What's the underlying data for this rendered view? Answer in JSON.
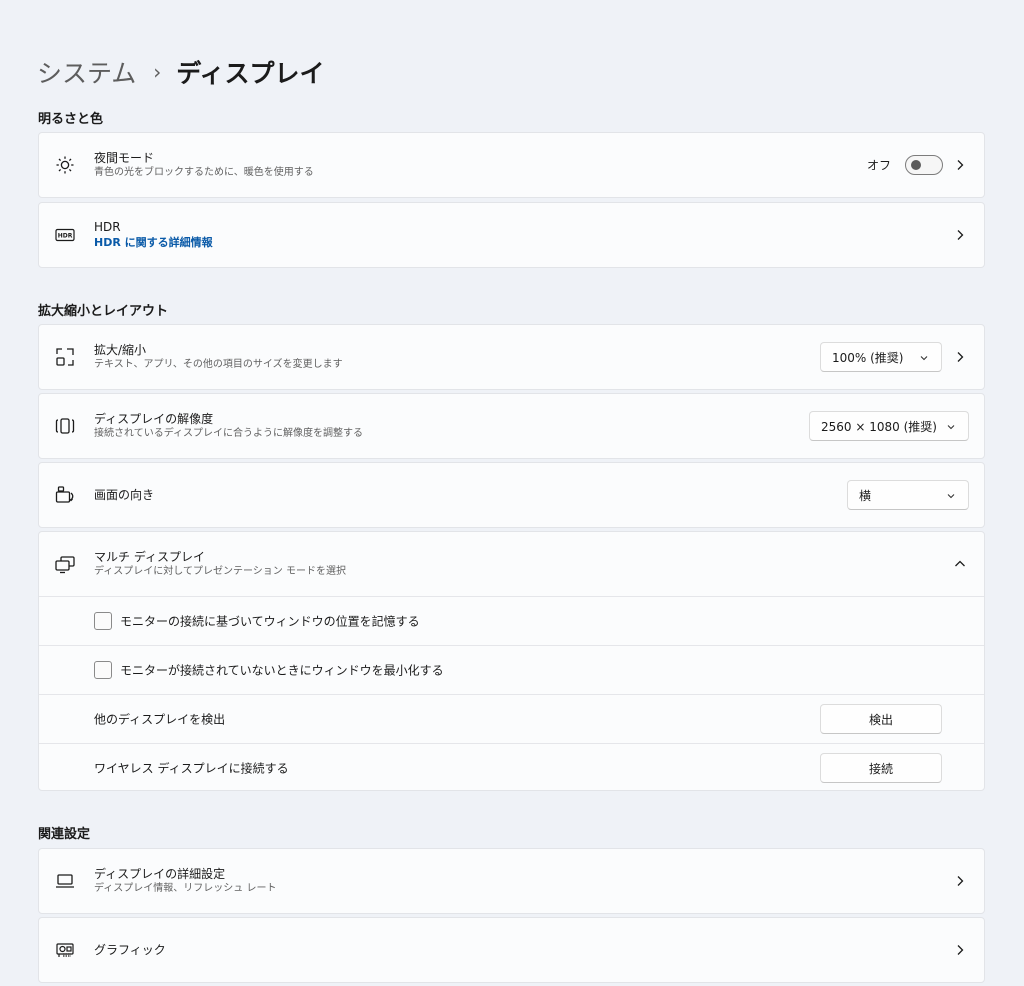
{
  "breadcrumb": {
    "parent": "システム",
    "separator": "›",
    "current": "ディスプレイ"
  },
  "sections": {
    "brightness": "明るさと色",
    "scale_layout": "拡大縮小とレイアウト",
    "related": "関連設定"
  },
  "night_light": {
    "icon": "brightness-icon",
    "title": "夜間モード",
    "description": "青色の光をブロックするために、暖色を使用する",
    "toggle_label": "オフ",
    "toggle_state": false
  },
  "hdr": {
    "icon": "hdr-icon",
    "title": "HDR",
    "link": "HDR に関する詳細情報"
  },
  "scale": {
    "icon": "scale-icon",
    "title": "拡大/縮小",
    "description": "テキスト、アプリ、その他の項目のサイズを変更します",
    "value": "100% (推奨)"
  },
  "resolution": {
    "icon": "resolution-icon",
    "title": "ディスプレイの解像度",
    "description": "接続されているディスプレイに合うように解像度を調整する",
    "value": "2560 × 1080 (推奨)"
  },
  "orientation": {
    "icon": "orientation-icon",
    "title": "画面の向き",
    "value": "横"
  },
  "multi_display": {
    "icon": "multi-display-icon",
    "title": "マルチ ディスプレイ",
    "description": "ディスプレイに対してプレゼンテーション モードを選択",
    "expanded": true,
    "remember_positions": {
      "label": "モニターの接続に基づいてウィンドウの位置を記憶する",
      "checked": false
    },
    "minimize_windows": {
      "label": "モニターが接続されていないときにウィンドウを最小化する",
      "checked": false
    },
    "detect": {
      "label": "他のディスプレイを検出",
      "button": "検出"
    },
    "wireless": {
      "label": "ワイヤレス ディスプレイに接続する",
      "button": "接続"
    }
  },
  "advanced_display": {
    "icon": "monitor-icon",
    "title": "ディスプレイの詳細設定",
    "description": "ディスプレイ情報、リフレッシュ レート"
  },
  "graphics": {
    "icon": "graphics-card-icon",
    "title": "グラフィック"
  }
}
